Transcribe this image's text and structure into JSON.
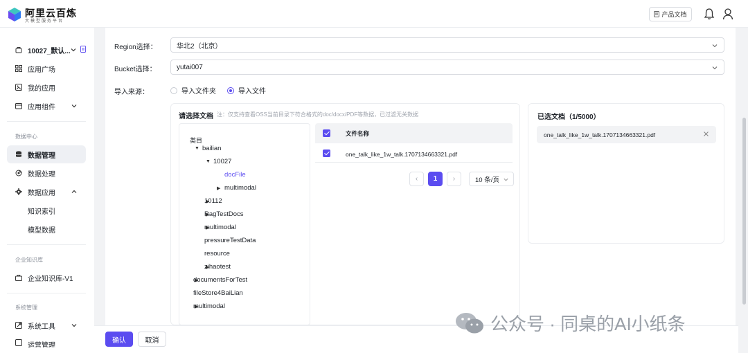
{
  "header": {
    "brand_title": "阿里云百炼",
    "brand_subtitle": "大模型服务平台",
    "doc_button": "产品文档"
  },
  "sidebar": {
    "workspace": "10027_默认...",
    "items_top": [
      {
        "label": "应用广场",
        "icon": "grid-icon"
      },
      {
        "label": "我的应用",
        "icon": "app-icon"
      },
      {
        "label": "应用组件",
        "icon": "component-icon"
      }
    ],
    "section_data": "数据中心",
    "items_data": [
      {
        "label": "数据管理",
        "icon": "database-icon"
      },
      {
        "label": "数据处理",
        "icon": "process-icon"
      },
      {
        "label": "数据应用",
        "icon": "settings-icon"
      }
    ],
    "items_data_sub": [
      "知识索引",
      "模型数据"
    ],
    "section_kb": "企业知识库",
    "kb_item": "企业知识库-V1",
    "section_sys": "系统管理",
    "sys_item": "系统工具",
    "sys_item_cut": "运营管理"
  },
  "form": {
    "region_label": "Region选择：",
    "region_value": "华北2（北京）",
    "bucket_label": "Bucket选择：",
    "bucket_value": "yutai007",
    "source_label": "导入来源：",
    "source_options": [
      "导入文件夹",
      "导入文件"
    ],
    "source_selected": "导入文件"
  },
  "picker": {
    "title": "请选择文档",
    "note": "注：仅支持查看OSS当前目录下符合格式的doc/docx/PDF等数据，已过滤无关数据",
    "tree_header": "类目",
    "tree": [
      {
        "label": "bailian",
        "caret": "▼"
      },
      {
        "label": "10027",
        "caret": "▼"
      },
      {
        "label": "docFile",
        "caret": ""
      },
      {
        "label": "multimodal",
        "caret": "▶"
      },
      {
        "label": "10112",
        "caret": "▶"
      },
      {
        "label": "RagTestDocs",
        "caret": "▶"
      },
      {
        "label": "multimodal",
        "caret": "▶"
      },
      {
        "label": "pressureTestData",
        "caret": ""
      },
      {
        "label": "resource",
        "caret": ""
      },
      {
        "label": "zihaotest",
        "caret": "▶"
      },
      {
        "label": "documentsForTest",
        "caret": "▶"
      },
      {
        "label": "fileStore4BaiLian",
        "caret": ""
      },
      {
        "label": "multimodal",
        "caret": "▶"
      }
    ],
    "table_header": "文件名称",
    "files": [
      "one_talk_like_1w_talk.1707134663321.pdf"
    ],
    "pager": {
      "current": "1",
      "page_size": "10 条/页",
      "prev": "‹",
      "next": "›"
    }
  },
  "selected": {
    "title": "已选文档（1/5000）",
    "items": [
      "one_talk_like_1w_talk.1707134663321.pdf"
    ]
  },
  "footer": {
    "confirm": "确认",
    "cancel": "取消"
  },
  "watermark": "公众号 · 同桌的AI小纸条",
  "colors": {
    "accent": "#5b4cf0",
    "border": "#d9dce1",
    "bg": "#f2f3f5"
  }
}
